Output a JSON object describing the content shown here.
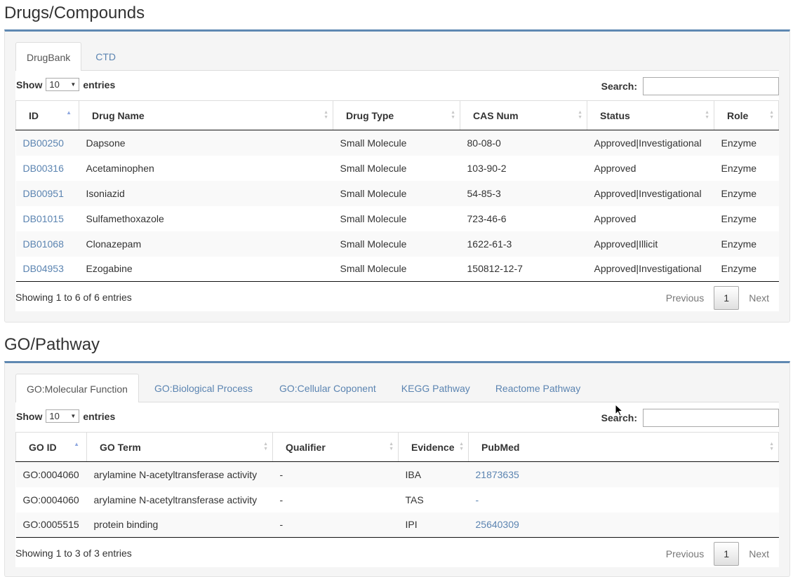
{
  "drugs": {
    "title": "Drugs/Compounds",
    "tabs": [
      "DrugBank",
      "CTD"
    ],
    "active_tab": 0,
    "show_label": "Show",
    "length_value": "10",
    "entries_label": "entries",
    "search_label": "Search:",
    "columns": [
      "ID",
      "Drug Name",
      "Drug Type",
      "CAS Num",
      "Status",
      "Role"
    ],
    "rows": [
      [
        "DB00250",
        "Dapsone",
        "Small Molecule",
        "80-08-0",
        "Approved|Investigational",
        "Enzyme"
      ],
      [
        "DB00316",
        "Acetaminophen",
        "Small Molecule",
        "103-90-2",
        "Approved",
        "Enzyme"
      ],
      [
        "DB00951",
        "Isoniazid",
        "Small Molecule",
        "54-85-3",
        "Approved|Investigational",
        "Enzyme"
      ],
      [
        "DB01015",
        "Sulfamethoxazole",
        "Small Molecule",
        "723-46-6",
        "Approved",
        "Enzyme"
      ],
      [
        "DB01068",
        "Clonazepam",
        "Small Molecule",
        "1622-61-3",
        "Approved|Illicit",
        "Enzyme"
      ],
      [
        "DB04953",
        "Ezogabine",
        "Small Molecule",
        "150812-12-7",
        "Approved|Investigational",
        "Enzyme"
      ]
    ],
    "info": "Showing 1 to 6 of 6 entries",
    "prev": "Previous",
    "page": "1",
    "next": "Next"
  },
  "go": {
    "title": "GO/Pathway",
    "tabs": [
      "GO:Molecular Function",
      "GO:Biological Process",
      "GO:Cellular Coponent",
      "KEGG Pathway",
      "Reactome Pathway"
    ],
    "active_tab": 0,
    "show_label": "Show",
    "length_value": "10",
    "entries_label": "entries",
    "search_label": "Search:",
    "columns": [
      "GO ID",
      "GO Term",
      "Qualifier",
      "Evidence",
      "PubMed"
    ],
    "rows": [
      [
        "GO:0004060",
        "arylamine N-acetyltransferase activity",
        "-",
        "IBA",
        "21873635"
      ],
      [
        "GO:0004060",
        "arylamine N-acetyltransferase activity",
        "-",
        "TAS",
        "-"
      ],
      [
        "GO:0005515",
        "protein binding",
        "-",
        "IPI",
        "25640309"
      ]
    ],
    "info": "Showing 1 to 3 of 3 entries",
    "prev": "Previous",
    "page": "1",
    "next": "Next"
  },
  "colors": {
    "link": "#5b84b1",
    "panel_border": "#5f88b2",
    "panel_bg": "#f5f5f5"
  }
}
